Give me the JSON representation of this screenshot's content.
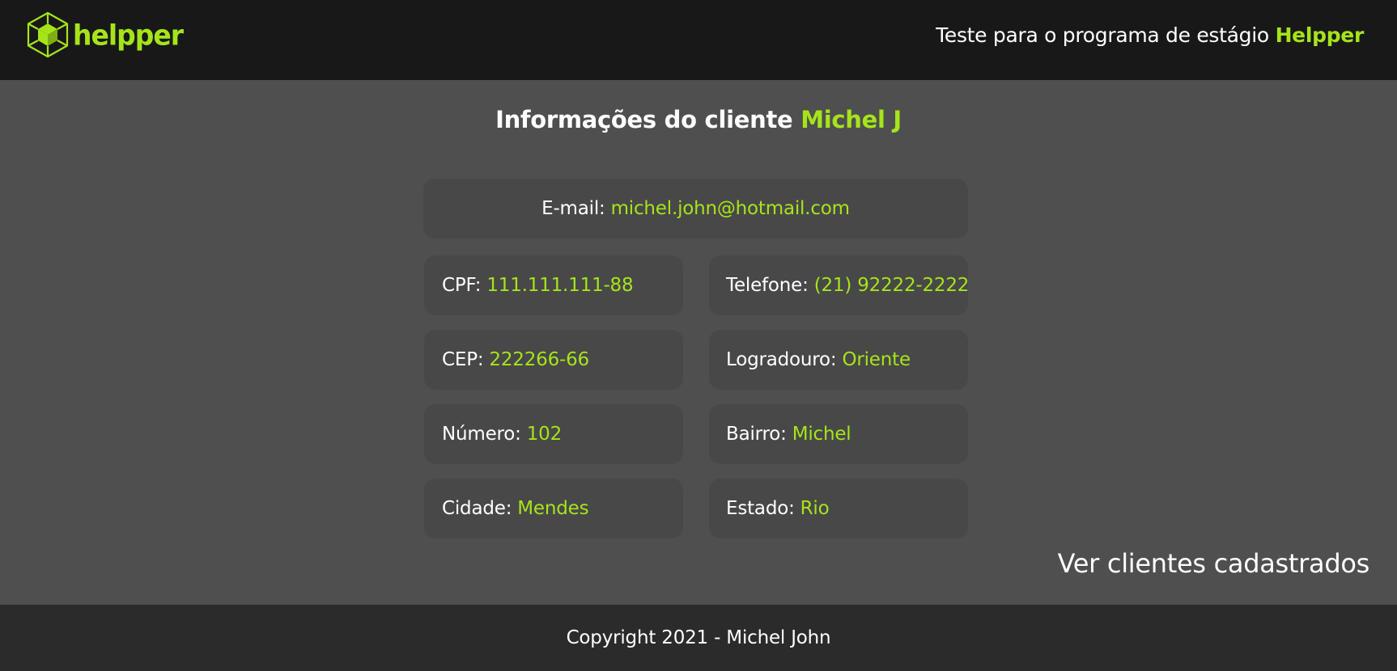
{
  "header": {
    "logo_text": "helpper",
    "tagline_prefix": "Teste para o programa de estágio",
    "tagline_brand": "Helpper"
  },
  "main": {
    "title_prefix": "Informações do cliente",
    "client_name": "Michel J",
    "fields": {
      "email": {
        "label": "E-mail:",
        "value": "michel.john@hotmail.com"
      },
      "cpf": {
        "label": "CPF:",
        "value": "111.111.111-88"
      },
      "telefone": {
        "label": "Telefone:",
        "value": "(21) 92222-2222"
      },
      "cep": {
        "label": "CEP:",
        "value": "222266-66"
      },
      "logradouro": {
        "label": "Logradouro:",
        "value": "Oriente"
      },
      "numero": {
        "label": "Número:",
        "value": "102"
      },
      "bairro": {
        "label": "Bairro:",
        "value": "Michel"
      },
      "cidade": {
        "label": "Cidade:",
        "value": "Mendes"
      },
      "estado": {
        "label": "Estado:",
        "value": "Rio"
      }
    },
    "see_clients_link": "Ver clientes cadastrados"
  },
  "footer": {
    "copyright": "Copyright 2021 - Michel John"
  },
  "colors": {
    "accent": "#a6e41a",
    "header_bg": "#181818",
    "page_bg": "#4f4f4f",
    "card_bg": "#484848",
    "footer_bg": "#2b2b2b"
  },
  "icons": {
    "logo": "cube-icon"
  }
}
